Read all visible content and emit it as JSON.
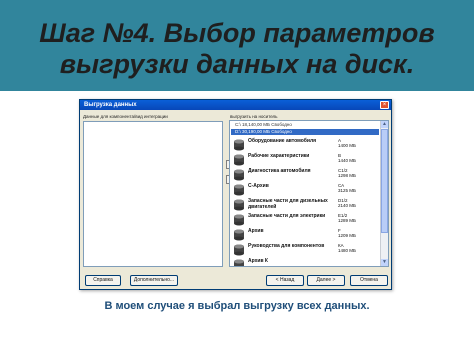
{
  "slide": {
    "title_line1": "Шаг №4. Выбор параметров",
    "title_line2": "выгрузки данных на диск.",
    "caption": "В моем случае я выбрал выгрузку всех данных."
  },
  "dialog": {
    "title": "Выгрузка данных",
    "close_glyph": "×",
    "left_label": "Данные для компонента/вид интеграции",
    "right_label": "выгрузить на носитель",
    "arrow_right": "»",
    "arrow_left": "«",
    "drives": [
      {
        "label": "C:\\ 18,140,00 МБ Свободно",
        "selected": false
      },
      {
        "label": "D:\\ 30,190,00 МБ Свободно",
        "selected": true
      }
    ],
    "items": [
      {
        "name": "Оборудование автомобиля",
        "info_1": "А",
        "info_2": "1400 МБ"
      },
      {
        "name": "Рабочие характеристики",
        "info_1": "В",
        "info_2": "1440 МБ"
      },
      {
        "name": "Диагностика автомобиля",
        "info_1": "С1/2",
        "info_2": "1298 МБ"
      },
      {
        "name": "С-Архив",
        "info_1": "СА",
        "info_2": "3125 МБ"
      },
      {
        "name": "Запасные части для дизельных двигателей",
        "info_1": "D1/2",
        "info_2": "2140 МБ"
      },
      {
        "name": "Запасные части для электрики",
        "info_1": "Е1/2",
        "info_2": "1289 МБ"
      },
      {
        "name": "Архив",
        "info_1": "F",
        "info_2": "1209 МБ"
      },
      {
        "name": "Руководства для компонентов",
        "info_1": "КА",
        "info_2": "1480 МБ"
      },
      {
        "name": "Архив К",
        "info_1": "",
        "info_2": ""
      }
    ],
    "buttons": {
      "help": "Справка",
      "extra": "Дополнительно...",
      "back": "< Назад",
      "next": "Далее >",
      "cancel": "Отмена"
    }
  },
  "colors": {
    "header_band": "#31859c",
    "titlebar": "#0a5fd8",
    "caption_text": "#1f4e79",
    "selection": "#316ac5"
  },
  "icons": {
    "item_icon": "database-icon"
  }
}
